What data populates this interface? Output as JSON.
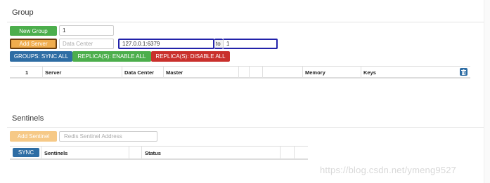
{
  "group": {
    "title": "Group",
    "new_group_label": "New Group",
    "group_id_value": "1",
    "add_server_label": "Add Server",
    "data_center_placeholder": "Data Center",
    "server_addr_value": "127.0.0.1:6379",
    "to_label": "to",
    "to_group_value": "1",
    "sync_all_label": "GROUPS: SYNC ALL",
    "enable_all_label": "REPLICA(S): ENABLE ALL",
    "disable_all_label": "REPLICA(S): DISABLE ALL",
    "table": {
      "id": "1",
      "columns": [
        "Server",
        "Data Center",
        "Master",
        "Memory",
        "Keys"
      ]
    }
  },
  "sentinels": {
    "title": "Sentinels",
    "add_sentinel_label": "Add Sentinel",
    "address_placeholder": "Redis Sentinel Address",
    "sync_label": "SYNC",
    "columns": [
      "Sentinels",
      "Status"
    ]
  },
  "watermark": "https://blog.csdn.net/ymeng9527",
  "colors": {
    "green": "#4cae4c",
    "orange": "#f0ad4e",
    "orange_light": "#f6c987",
    "blue": "#2e6da4",
    "red": "#c9302c",
    "focus_border": "#2222aa",
    "active_border": "#6a3d0d"
  },
  "icons": {
    "trash": "trash-icon"
  }
}
